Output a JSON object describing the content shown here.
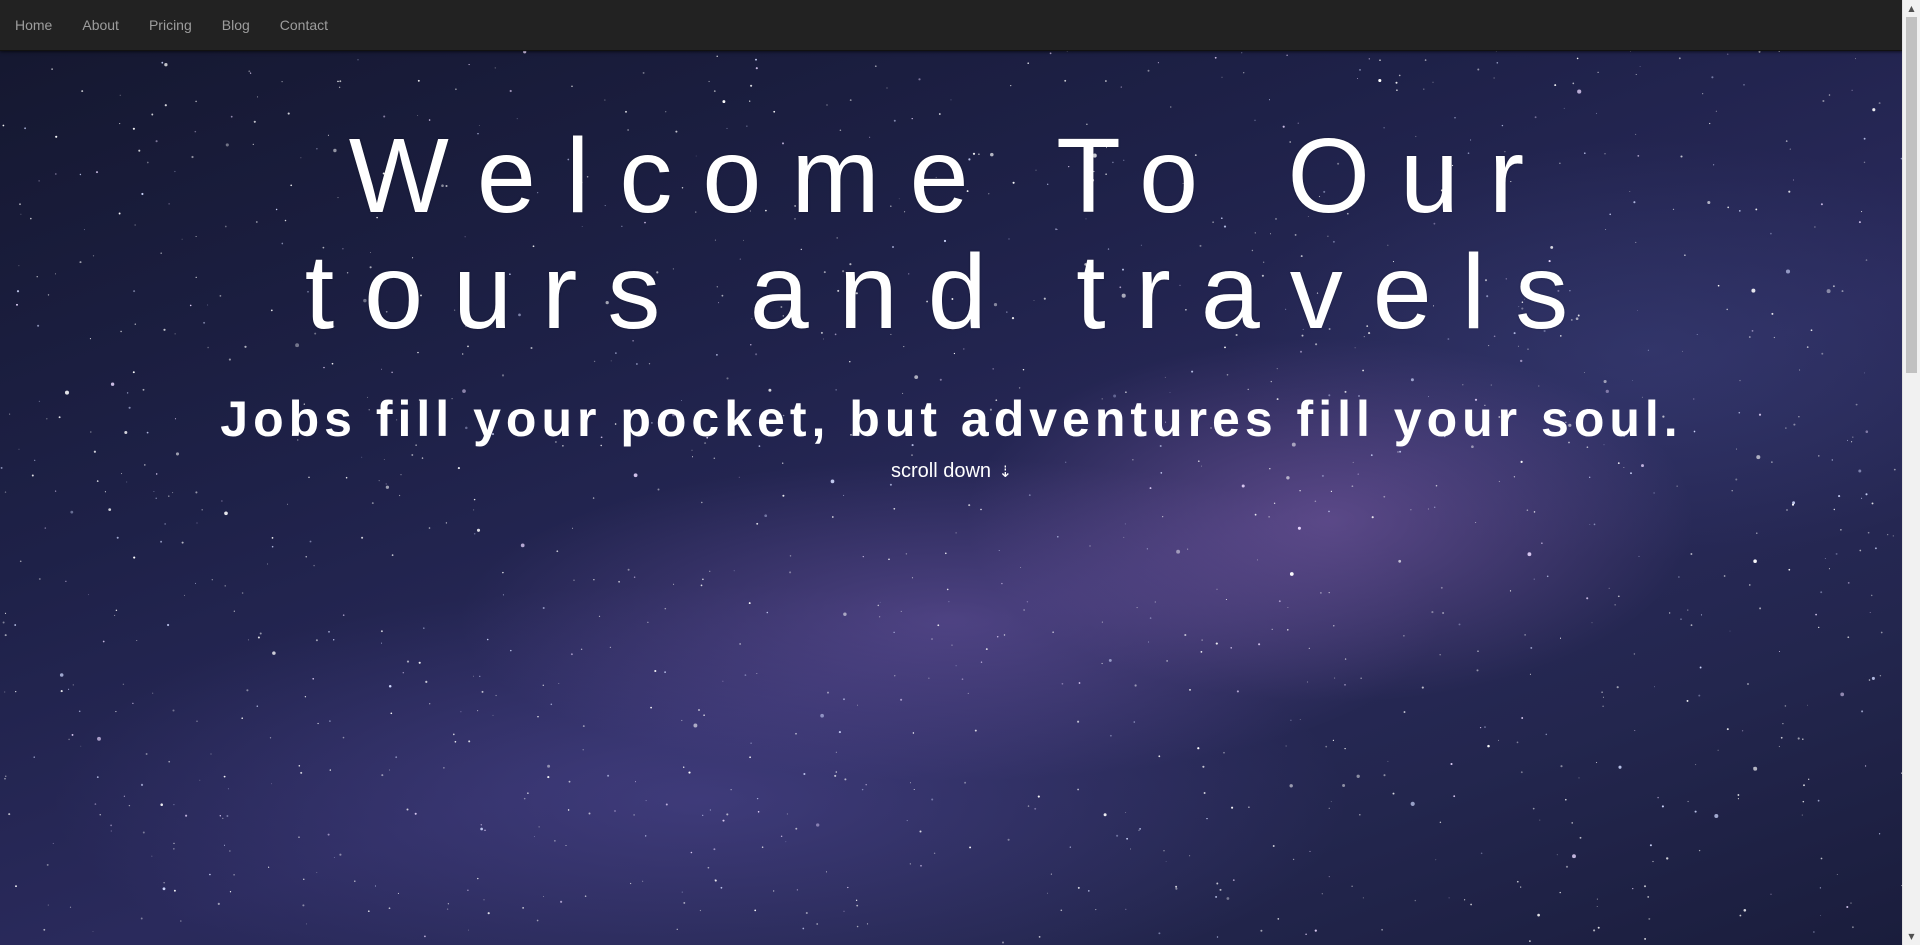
{
  "navbar": {
    "items": [
      {
        "label": "Home"
      },
      {
        "label": "About"
      },
      {
        "label": "Pricing"
      },
      {
        "label": "Blog"
      },
      {
        "label": "Contact"
      }
    ]
  },
  "hero": {
    "title_line1": "Welcome To Our",
    "title_line2": "tours and travels",
    "subtitle": "Jobs fill your pocket, but adventures fill your soul.",
    "scroll_label": "scroll down",
    "scroll_icon": "down-dashed-arrow-icon",
    "scroll_glyph": "⇣"
  },
  "colors": {
    "navbar_bg": "#222222",
    "nav_text": "#9d9d9d",
    "hero_text": "#ffffff"
  }
}
